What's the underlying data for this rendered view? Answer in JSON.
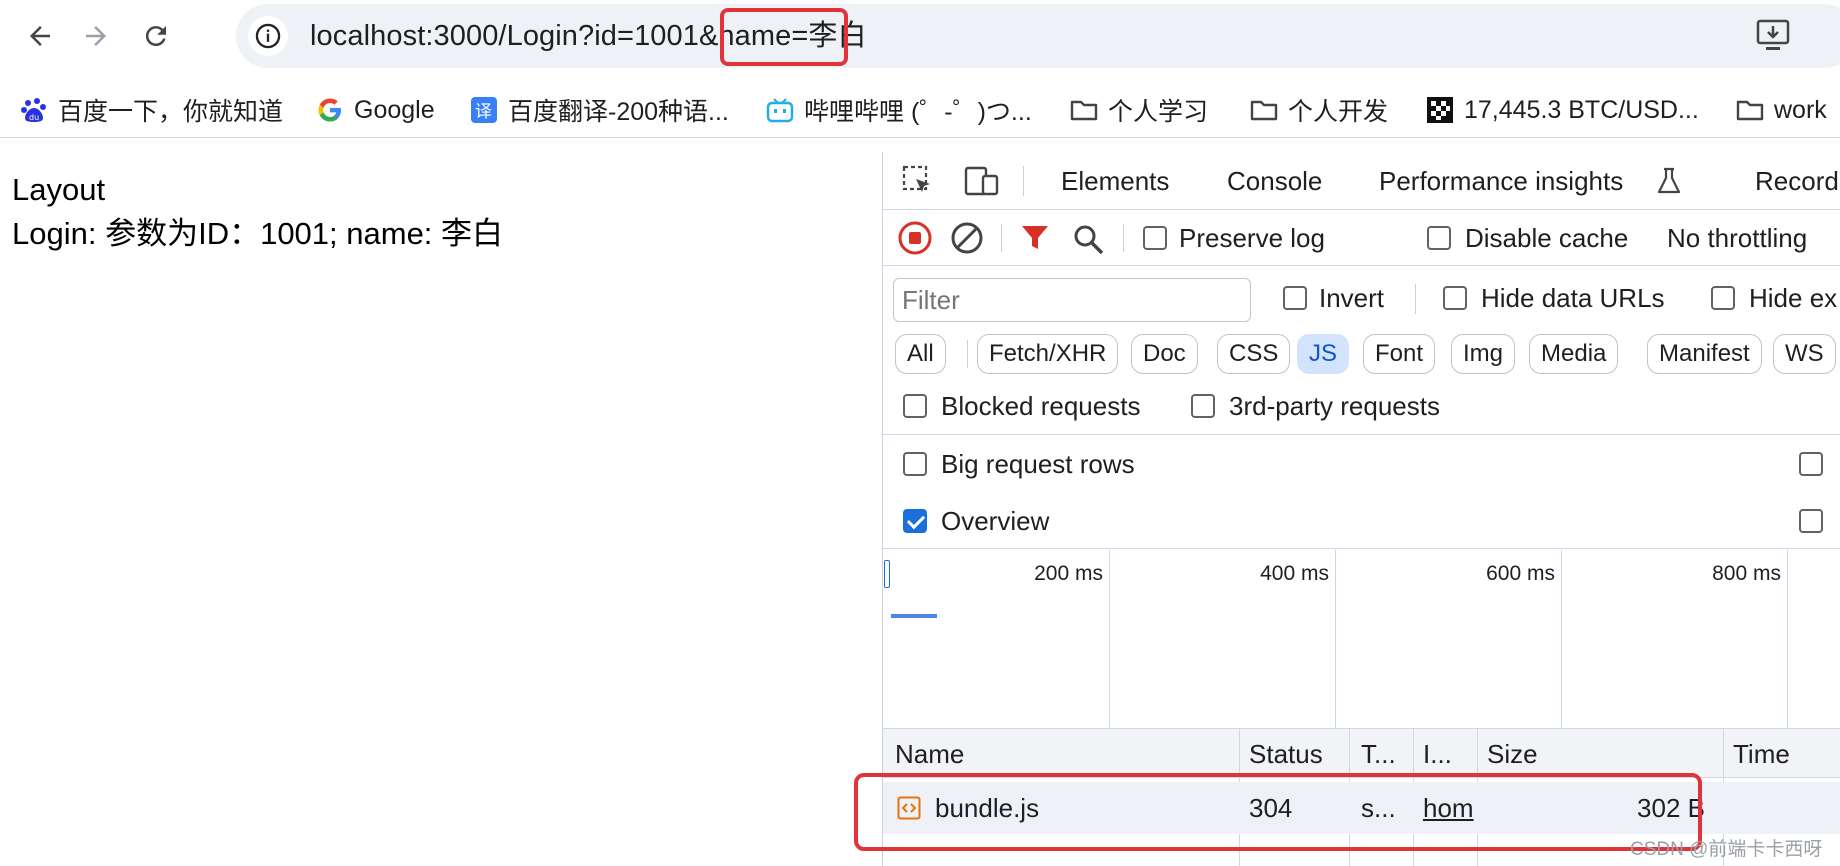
{
  "browser": {
    "url": "localhost:3000/Login?id=1001&name=李白"
  },
  "bookmarks": [
    {
      "label": "百度一下，你就知道",
      "icon": "baidu-paw-icon"
    },
    {
      "label": "Google",
      "icon": "google-g-icon"
    },
    {
      "label": "百度翻译-200种语...",
      "icon": "translate-icon"
    },
    {
      "label": "哔哩哔哩 (゜-゜)つ...",
      "icon": "bilibili-icon"
    },
    {
      "label": "个人学习",
      "icon": "folder-icon"
    },
    {
      "label": "个人开发",
      "icon": "folder-icon"
    },
    {
      "label": "17,445.3 BTC/USD...",
      "icon": "pattern-icon"
    },
    {
      "label": "work",
      "icon": "folder-icon"
    }
  ],
  "page": {
    "line1": "Layout",
    "line2": "Login: 参数为ID：1001; name: 李白"
  },
  "devtools": {
    "tabs": [
      "Elements",
      "Console",
      "Performance insights",
      "Record"
    ],
    "network_toolbar": {
      "preserve_log": "Preserve log",
      "disable_cache": "Disable cache",
      "throttling": "No throttling"
    },
    "filter": {
      "placeholder": "Filter",
      "invert": "Invert",
      "hide_data_urls": "Hide data URLs",
      "hide_ext": "Hide ex"
    },
    "type_chips": [
      "All",
      "Fetch/XHR",
      "Doc",
      "CSS",
      "JS",
      "Font",
      "Img",
      "Media",
      "Manifest",
      "WS"
    ],
    "active_chip": "JS",
    "blocked_requests": "Blocked requests",
    "third_party": "3rd-party requests",
    "big_request_rows": "Big request rows",
    "overview": "Overview",
    "overview_checked": true,
    "timeline_labels": [
      "200 ms",
      "400 ms",
      "600 ms",
      "800 ms"
    ],
    "columns": [
      "Name",
      "Status",
      "T...",
      "I...",
      "Size",
      "Time"
    ],
    "rows": [
      {
        "name": "bundle.js",
        "status": "304",
        "type": "s...",
        "initiator": "hom",
        "size": "302 B",
        "time": ""
      }
    ]
  },
  "watermark": "CSDN @前端卡卡西呀",
  "colors": {
    "highlight": "#e0333a",
    "accent": "#1a6fdb",
    "active_chip_bg": "#d3e3fd"
  }
}
